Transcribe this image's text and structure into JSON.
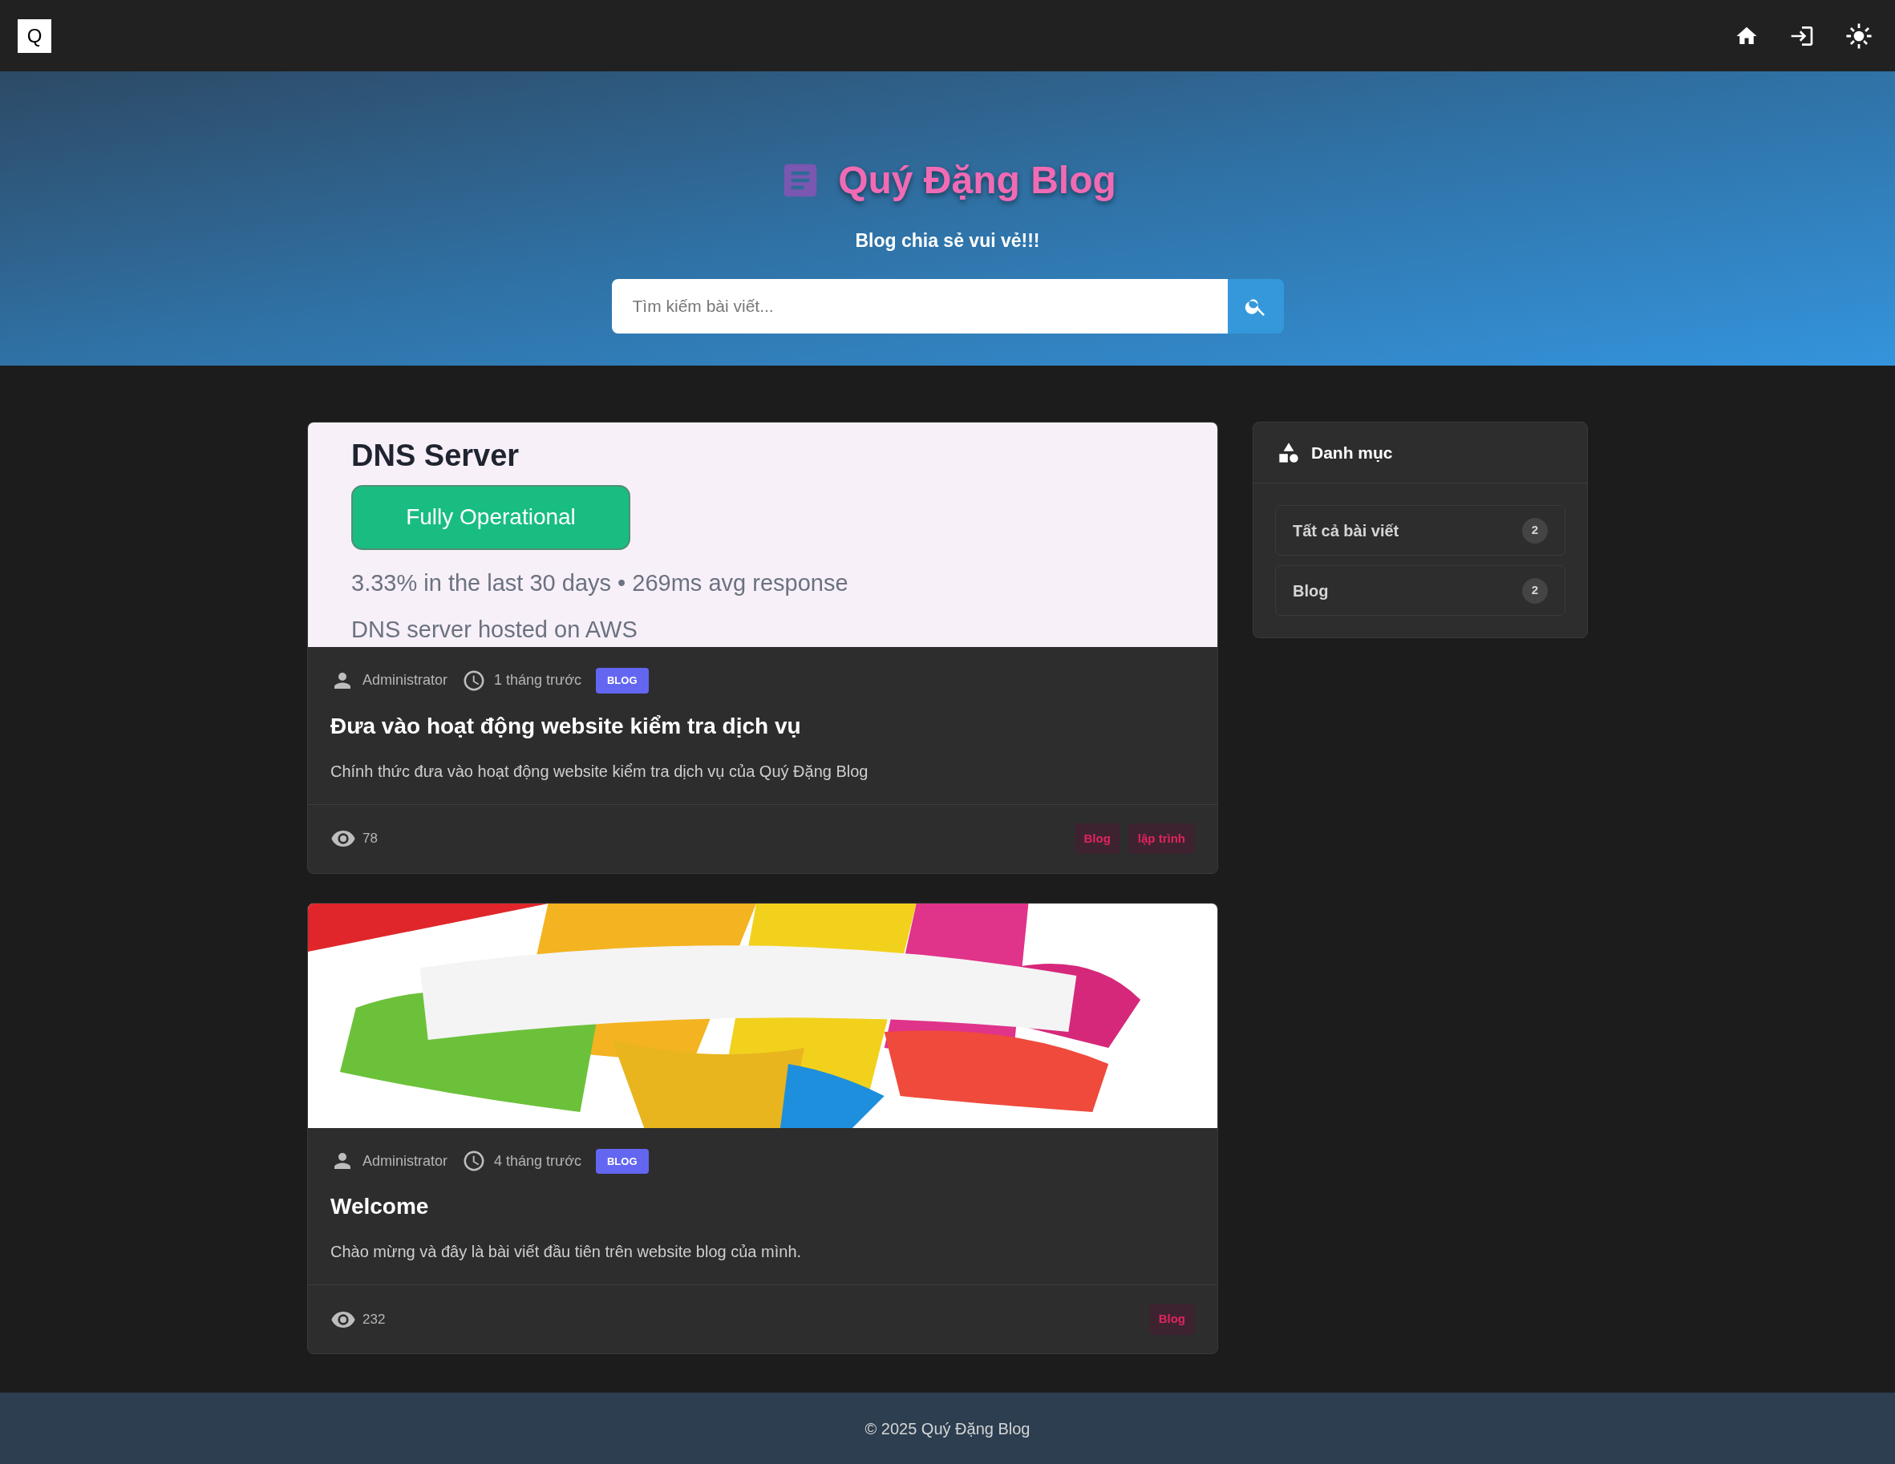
{
  "navbar": {
    "logo": "Q"
  },
  "hero": {
    "title": "Quý Đặng Blog",
    "subtitle": "Blog chia sẻ vui vẻ!!!",
    "search": {
      "placeholder": "Tìm kiếm bài viết..."
    }
  },
  "posts": [
    {
      "image": {
        "kind": "screenshot",
        "heading": "DNS Server",
        "status": "Fully Operational",
        "stats": "3.33% in the last 30 days • 269ms avg response",
        "note": "DNS server hosted on AWS"
      },
      "author": "Administrator",
      "time": "1 tháng trước",
      "category": "BLOG",
      "title": "Đưa vào hoạt động website kiểm tra dịch vụ",
      "excerpt": "Chính thức đưa vào hoạt động website kiểm tra dịch vụ của Quý Đặng Blog",
      "views": "78",
      "tags": [
        "Blog",
        "lập trình"
      ]
    },
    {
      "image": {
        "kind": "picture"
      },
      "author": "Administrator",
      "time": "4 tháng trước",
      "category": "BLOG",
      "title": "Welcome",
      "excerpt": "Chào mừng và đây là bài viết đầu tiên trên website blog của mình.",
      "views": "232",
      "tags": [
        "Blog"
      ]
    }
  ],
  "sidebar": {
    "title": "Danh mục",
    "items": [
      {
        "label": "Tất cả bài viết",
        "count": "2"
      },
      {
        "label": "Blog",
        "count": "2"
      }
    ]
  },
  "footer": {
    "text": "© 2025 Quý Đặng Blog"
  }
}
